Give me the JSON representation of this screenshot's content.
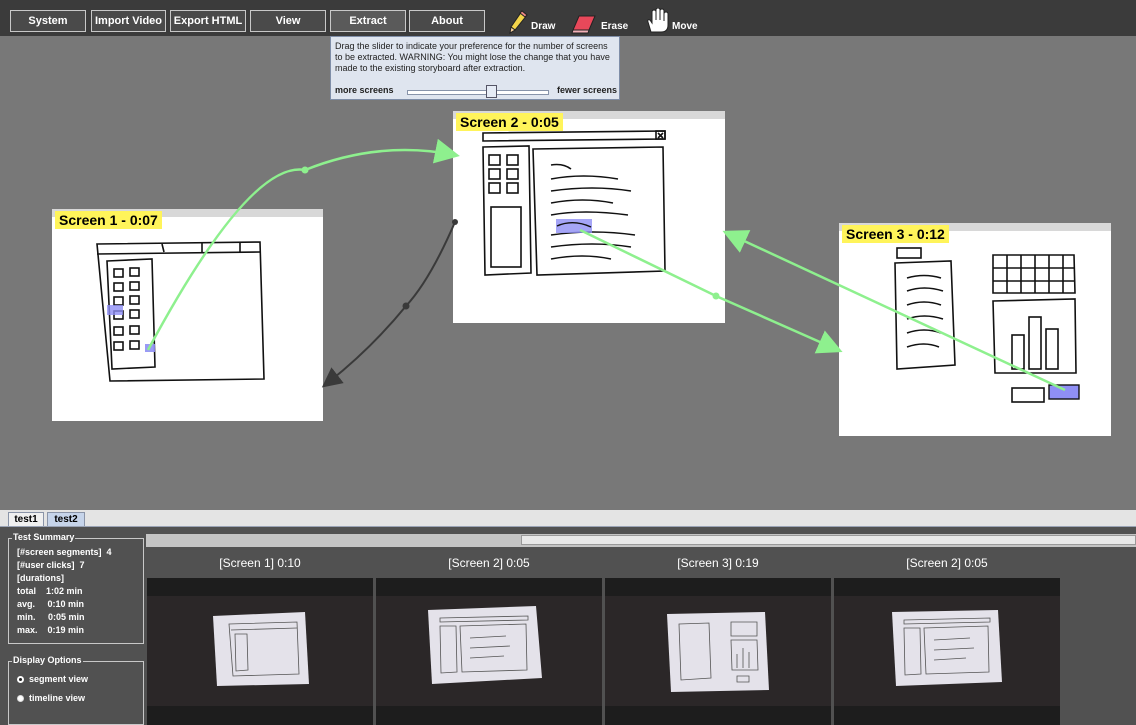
{
  "toolbar": {
    "buttons": [
      "System",
      "Import Video",
      "Export HTML",
      "View",
      "Extract",
      "About"
    ],
    "tools": [
      "Draw",
      "Erase",
      "Move"
    ]
  },
  "extract_popup": {
    "message": "Drag the slider to indicate your preference for the number of screens to be extracted. WARNING: You might lose the change that you have made to the existing storyboard after extraction.",
    "left_label": "more screens",
    "right_label": "fewer screens",
    "slider_value": 0.59
  },
  "screens": [
    {
      "title": "Screen 1 - 0:07"
    },
    {
      "title": "Screen 2 - 0:05"
    },
    {
      "title": "Screen 3 - 0:12"
    }
  ],
  "tabs": [
    "test1",
    "test2"
  ],
  "test_summary": {
    "legend": "Test Summary",
    "lines": [
      "[#screen segments]  4",
      "[#user clicks]  7",
      "[durations]",
      "total    1:02 min",
      "avg.     0:10 min",
      "min.     0:05 min",
      "max.    0:19 min"
    ]
  },
  "display_options": {
    "legend": "Display Options",
    "options": [
      "segment view",
      "timeline view"
    ],
    "selected": "segment view"
  },
  "segments": [
    {
      "label": "[Screen 1] 0:10"
    },
    {
      "label": "[Screen 2] 0:05"
    },
    {
      "label": "[Screen 3] 0:19"
    },
    {
      "label": "[Screen 2] 0:05"
    }
  ],
  "colors": {
    "title_highlight": "#fff45a",
    "flow_arrow": "#8ef08e",
    "back_arrow": "#3a3a3a",
    "click_highlight": "#8f8ff5"
  }
}
